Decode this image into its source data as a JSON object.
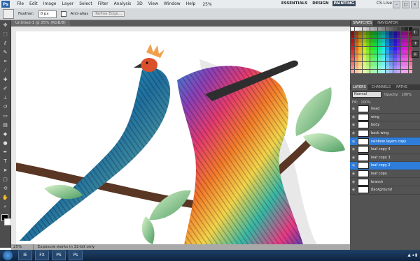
{
  "menubar": {
    "logo": "Ps",
    "items": [
      "File",
      "Edit",
      "Image",
      "Layer",
      "Select",
      "Filter",
      "Analysis",
      "3D",
      "View",
      "Window",
      "Help"
    ],
    "zoom": "25%",
    "workspaces": [
      "ESSENTIALS",
      "DESIGN",
      "PAINTING"
    ],
    "active_workspace": "PAINTING",
    "cs_live": "CS Live"
  },
  "options": {
    "feather_label": "Feather:",
    "feather_value": "0 px",
    "antialias_label": "Anti-alias",
    "refine_label": "Refine Edge..."
  },
  "document": {
    "tab_title": "Untitled-1 @ 25% (RGB/8)",
    "zoom": "25%",
    "status": "Exposure works in 32-bit only"
  },
  "panels": {
    "swatches_tabs": [
      "SWATCHES",
      "NAVIGATOR"
    ],
    "layers_tabs": [
      "LAYERS",
      "CHANNELS",
      "PATHS"
    ],
    "blend_mode": "Normal",
    "opacity_label": "Opacity:",
    "opacity_value": "100%",
    "fill_label": "Fill:",
    "fill_value": "100%"
  },
  "layers": [
    {
      "name": "head",
      "selected": false
    },
    {
      "name": "wing",
      "selected": false
    },
    {
      "name": "body",
      "selected": false
    },
    {
      "name": "back wing",
      "selected": false
    },
    {
      "name": "rainbow layers copy",
      "selected": true
    },
    {
      "name": "leaf copy 4",
      "selected": false
    },
    {
      "name": "leaf copy 3",
      "selected": false
    },
    {
      "name": "leaf copy 2",
      "selected": true
    },
    {
      "name": "leaf copy",
      "selected": false
    },
    {
      "name": "branch",
      "selected": false
    },
    {
      "name": "Background",
      "selected": false
    }
  ],
  "taskbar": {
    "apps": [
      "IE",
      "FX",
      "PS",
      "Ps"
    ]
  }
}
